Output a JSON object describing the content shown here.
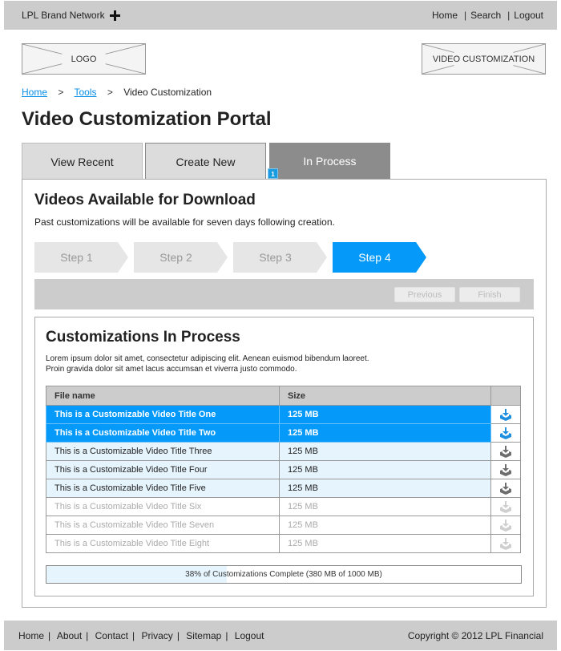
{
  "header": {
    "brand": "LPL Brand Network",
    "nav": [
      "Home",
      "Search",
      "Logout"
    ]
  },
  "placeholders": {
    "logo": "LOGO",
    "section_banner": "VIDEO CUSTOMIZATION"
  },
  "breadcrumb": {
    "items": [
      "Home",
      "Tools"
    ],
    "current": "Video Customization",
    "separator": ">"
  },
  "page_title": "Video Customization Portal",
  "tabs": [
    {
      "label": "View Recent",
      "active": false
    },
    {
      "label": "Create New",
      "active": false
    },
    {
      "label": "In Process",
      "active": true,
      "badge": "1"
    }
  ],
  "panel": {
    "title": "Videos Available for Download",
    "subtitle": "Past customizations will be available for seven days following creation."
  },
  "steps": {
    "items": [
      "Step 1",
      "Step 2",
      "Step 3",
      "Step 4"
    ],
    "active_index": 3,
    "colors": {
      "inactive": "#e6e6e6",
      "active": "#0599fa"
    }
  },
  "actions": {
    "previous": "Previous",
    "finish": "Finish"
  },
  "customizations": {
    "title": "Customizations In Process",
    "description_line1": "Lorem ipsum dolor sit amet, consectetur adipiscing elit. Aenean euismod bibendum laoreet.",
    "description_line2": "Proin gravida dolor sit amet lacus accumsan et viverra justo commodo.",
    "columns": [
      "File name",
      "Size",
      ""
    ],
    "rows": [
      {
        "name": "This is a Customizable Video Title One",
        "size": "125 MB",
        "state": "selected",
        "icon": "download-icon"
      },
      {
        "name": "This is a Customizable Video Title Two",
        "size": "125 MB",
        "state": "selected",
        "icon": "download-icon"
      },
      {
        "name": "This is a Customizable Video Title Three",
        "size": "125 MB",
        "state": "available",
        "icon": "download-icon"
      },
      {
        "name": "This is a Customizable Video Title Four",
        "size": "125 MB",
        "state": "available",
        "icon": "download-icon"
      },
      {
        "name": "This is a Customizable Video Title Five",
        "size": "125 MB",
        "state": "available",
        "icon": "download-icon"
      },
      {
        "name": "This is a Customizable Video Title Six",
        "size": "125 MB",
        "state": "disabled",
        "icon": "download-icon"
      },
      {
        "name": "This is a Customizable Video Title Seven",
        "size": "125 MB",
        "state": "disabled",
        "icon": "download-icon"
      },
      {
        "name": "This is a Customizable Video Title Eight",
        "size": "125 MB",
        "state": "disabled",
        "icon": "download-icon"
      }
    ],
    "progress": {
      "percent": 38,
      "label": "38% of Customizations Complete (380 MB of 1000 MB)"
    }
  },
  "footer": {
    "nav": [
      "Home",
      "About",
      "Contact",
      "Privacy",
      "Sitemap",
      "Logout"
    ],
    "copyright": "Copyright © 2012 LPL Financial"
  },
  "colors": {
    "accent": "#0599fa",
    "link": "#0a8fe6",
    "bar_gray": "#cccccc",
    "active_tab": "#8c8c8c",
    "row_highlight": "#e6f4fd"
  }
}
